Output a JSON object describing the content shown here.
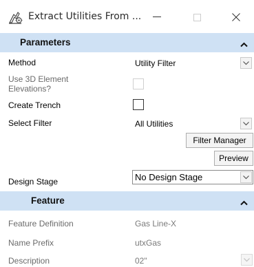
{
  "window": {
    "title": "Extract Utilities From ...",
    "icons": {
      "app": "utility-settings-icon",
      "minimize": "minimize-icon",
      "maximize": "maximize-icon",
      "close": "close-icon"
    }
  },
  "parameters": {
    "header": "Parameters",
    "method": {
      "label": "Method",
      "value": "Utility Filter"
    },
    "use3d": {
      "label_line1": "Use 3D Element",
      "label_line2": "Elevations?",
      "checked": false,
      "enabled": false
    },
    "create_trench": {
      "label": "Create Trench",
      "checked": false
    },
    "select_filter": {
      "label": "Select Filter",
      "value": "All Utilities"
    },
    "filter_manager_label": "Filter Manager",
    "preview_label": "Preview",
    "design_stage": {
      "label": "Design Stage",
      "value": "No Design Stage"
    }
  },
  "feature": {
    "header": "Feature",
    "definition": {
      "label": "Feature Definition",
      "value": "Gas Line-X"
    },
    "name_prefix": {
      "label": "Name Prefix",
      "value": "utxGas"
    },
    "description": {
      "label": "Description",
      "value": "02\""
    }
  },
  "colors": {
    "section_header_bg": "#cfe1f4",
    "disabled_text": "#7a7a7a"
  }
}
